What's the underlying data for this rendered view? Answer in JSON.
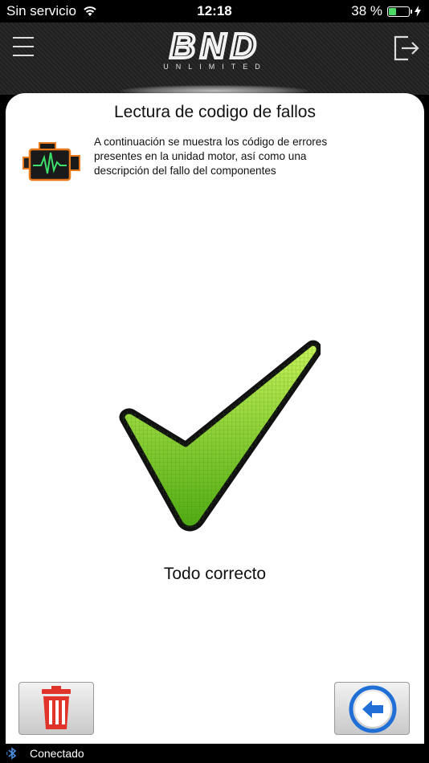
{
  "status_bar": {
    "carrier": "Sin servicio",
    "time": "12:18",
    "battery_percent_text": "38 %",
    "battery_level": 0.38,
    "wifi_icon": "wifi-icon",
    "charging_icon": "bolt-icon"
  },
  "header": {
    "logo_main": "BND",
    "logo_sub": "UNLIMITED",
    "menu_icon": "hamburger-icon",
    "exit_icon": "exit-icon"
  },
  "card": {
    "title": "Lectura de codigo de fallos",
    "description": "A continuación se muestra los código de errores presentes en la unidad motor, así como una descripción del fallo del componentes",
    "engine_icon": "engine-icon",
    "result_icon": "checkmark-icon",
    "result_text": "Todo correcto"
  },
  "buttons": {
    "delete_icon": "trash-icon",
    "back_icon": "arrow-left-icon"
  },
  "bottom_bar": {
    "status": "Conectado",
    "icon": "bluetooth-icon"
  },
  "colors": {
    "accent_green": "#7fd11a",
    "delete_red": "#e0342b",
    "back_blue": "#1f6fd6",
    "engine_orange": "#e87a1d"
  }
}
